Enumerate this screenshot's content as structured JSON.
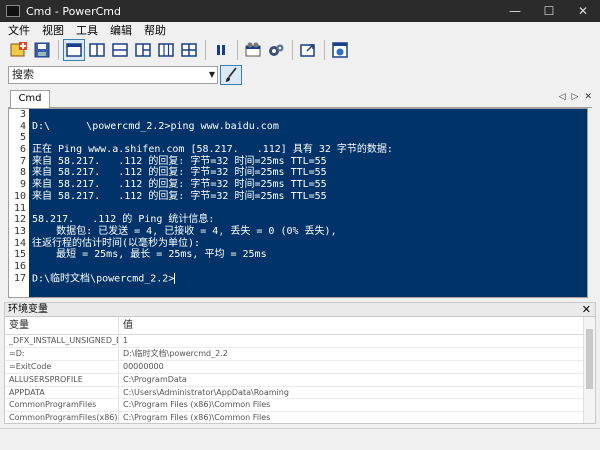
{
  "window": {
    "title": "Cmd - PowerCmd",
    "minimize": "—",
    "maximize": "☐",
    "close": "✕"
  },
  "menu": [
    "文件",
    "视图",
    "工具",
    "编辑",
    "帮助"
  ],
  "search": {
    "value": "搜索",
    "dropdown": "▼"
  },
  "tab": {
    "label": "Cmd",
    "nav_prev": "◁",
    "nav_next": "▷",
    "nav_close": "✕"
  },
  "console": {
    "line_numbers": [
      "3",
      "4",
      "5",
      "6",
      "7",
      "8",
      "9",
      "10",
      "11",
      "12",
      "13",
      "14",
      "15",
      "16",
      "17"
    ],
    "lines": [
      "",
      "D:\\      \\powercmd_2.2>ping www.baidu.com",
      "",
      "正在 Ping www.a.shifen.com [58.217.   .112] 具有 32 字节的数据:",
      "来自 58.217.   .112 的回复: 字节=32 时间=25ms TTL=55",
      "来自 58.217.   .112 的回复: 字节=32 时间=25ms TTL=55",
      "来自 58.217.   .112 的回复: 字节=32 时间=25ms TTL=55",
      "来自 58.217.   .112 的回复: 字节=32 时间=25ms TTL=55",
      "",
      "58.217.   .112 的 Ping 统计信息:",
      "    数据包: 已发送 = 4, 已接收 = 4, 丢失 = 0 (0% 丢失),",
      "往返行程的估计时间(以毫秒为单位):",
      "    最短 = 25ms, 最长 = 25ms, 平均 = 25ms",
      "",
      "D:\\临时文档\\powercmd_2.2>"
    ],
    "colors": {
      "background": "#01336b",
      "text": "#ffffff"
    }
  },
  "env": {
    "title": "环境变量",
    "close": "✕",
    "col_name": "变量",
    "col_value": "值",
    "rows": [
      {
        "name": "_DFX_INSTALL_UNSIGNED_D...",
        "value": "1"
      },
      {
        "name": "=D:",
        "value": "D:\\临时文档\\powercmd_2.2"
      },
      {
        "name": "=ExitCode",
        "value": "00000000"
      },
      {
        "name": "ALLUSERSPROFILE",
        "value": "C:\\ProgramData"
      },
      {
        "name": "APPDATA",
        "value": "C:\\Users\\Administrator\\AppData\\Roaming"
      },
      {
        "name": "CommonProgramFiles",
        "value": "C:\\Program Files (x86)\\Common Files"
      },
      {
        "name": "CommonProgramFiles(x86)",
        "value": "C:\\Program Files (x86)\\Common Files"
      }
    ]
  }
}
